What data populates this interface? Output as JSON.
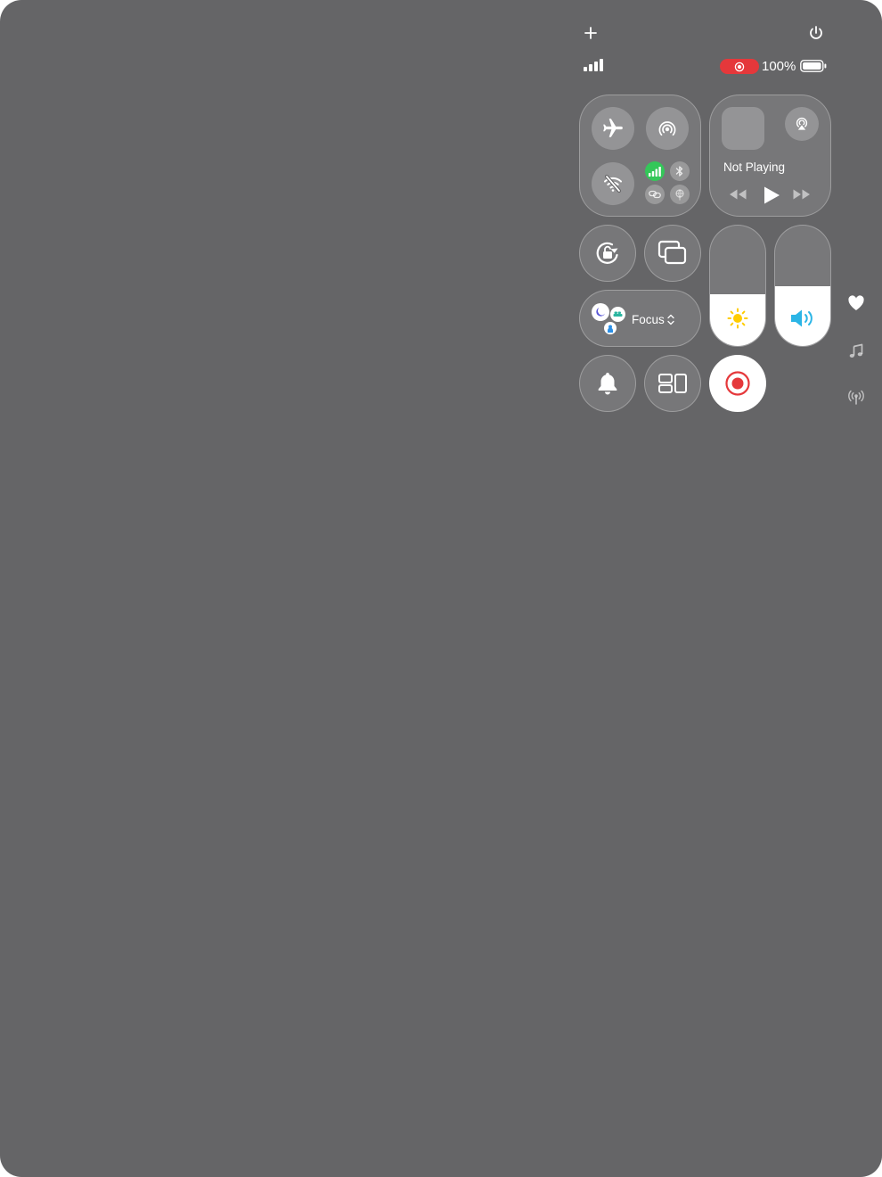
{
  "status_bar": {
    "battery_percent": "100%",
    "battery_level": 1.0,
    "signal_bars": 4,
    "recording_color": "#e5383b"
  },
  "top_controls": {
    "add_icon": "plus-icon",
    "power_icon": "power-icon"
  },
  "connectivity": {
    "airplane": "airplane-icon",
    "airdrop": "airdrop-icon",
    "wifi_off": "wifi-off-icon",
    "cellular": "cellular-icon",
    "cellular_color": "#34c759",
    "bluetooth": "bluetooth-icon",
    "link": "link-icon",
    "vpn": "vpn-icon"
  },
  "media": {
    "status": "Not Playing",
    "airplay_icon": "airplay-icon"
  },
  "focus": {
    "label": "Focus"
  },
  "sliders": {
    "brightness_level": 0.43,
    "volume_level": 0.5,
    "brightness_color": "#ffcc00",
    "volume_color": "#2bb5e6"
  },
  "side_dock": {
    "items": [
      "heart-icon",
      "music-note-icon",
      "broadcast-icon"
    ]
  }
}
